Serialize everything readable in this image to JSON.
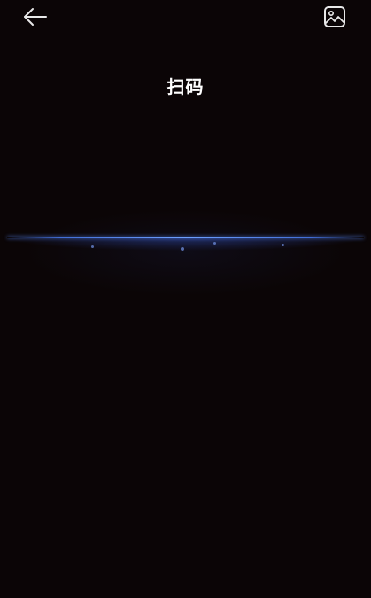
{
  "header": {
    "title": "扫码",
    "back_icon": "arrow-left-icon",
    "gallery_icon": "image-icon"
  },
  "colors": {
    "background": "#0b0506",
    "scan_line": "#5a8cff",
    "text": "#ffffff"
  }
}
